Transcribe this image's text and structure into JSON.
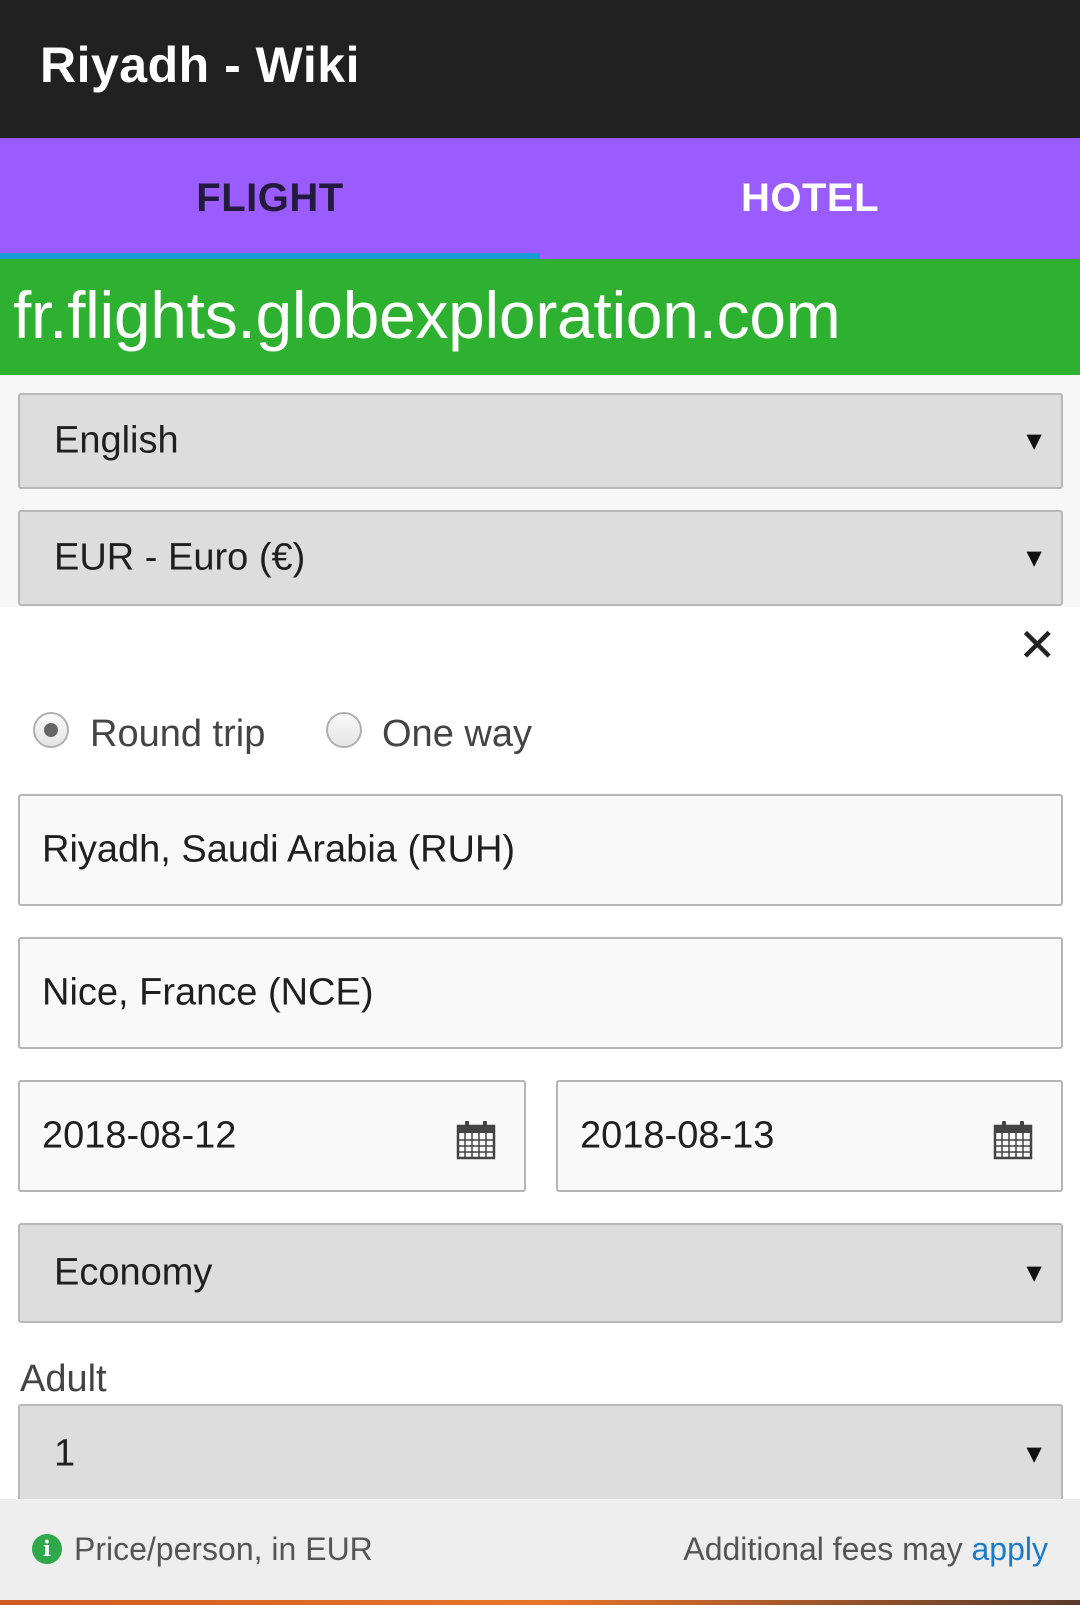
{
  "appbar": {
    "title": "Riyadh - Wiki"
  },
  "tabs": [
    {
      "label": "FLIGHT",
      "selected": true
    },
    {
      "label": "HOTEL",
      "selected": false
    }
  ],
  "banner": {
    "text": "fr.flights.globexploration.com"
  },
  "settings": {
    "language": "English",
    "currency": "EUR - Euro (€)"
  },
  "search": {
    "trip_types": [
      {
        "label": "Round trip",
        "selected": true
      },
      {
        "label": "One way",
        "selected": false
      }
    ],
    "origin": "Riyadh, Saudi Arabia (RUH)",
    "destination": "Nice, France (NCE)",
    "depart_date": "2018-08-12",
    "return_date": "2018-08-13",
    "cabin_class": "Economy",
    "adult_label": "Adult",
    "adult_count": "1",
    "close_glyph": "✕",
    "caret_glyph": "▼"
  },
  "footer": {
    "price_note": "Price/person, in EUR",
    "fees_prefix": "Additional fees may ",
    "fees_link": "apply",
    "info_glyph": "i"
  },
  "colors": {
    "appbar": "#212121",
    "tabbar": "#9b5cff",
    "tab_indicator": "#1a9ad6",
    "banner": "#2eb130",
    "link": "#1a7acb",
    "info_icon": "#2ea84a"
  }
}
